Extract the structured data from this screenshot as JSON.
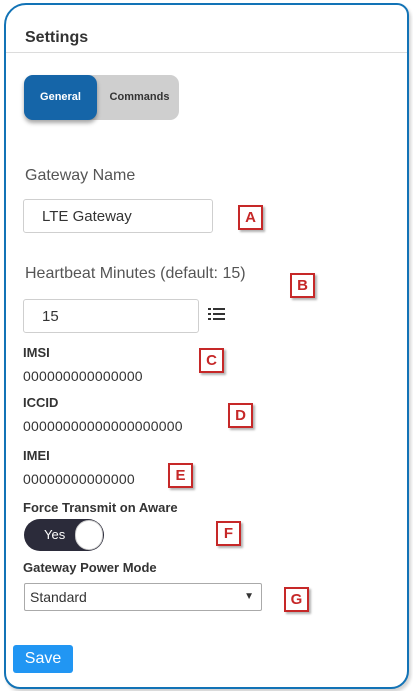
{
  "header": {
    "title": "Settings"
  },
  "tabs": [
    {
      "label": "General",
      "active": true
    },
    {
      "label": "Commands",
      "active": false
    }
  ],
  "fields": {
    "gateway_name": {
      "label": "Gateway Name",
      "value": "LTE Gateway"
    },
    "heartbeat": {
      "label": "Heartbeat Minutes (default: 15)",
      "value": "15"
    },
    "imsi": {
      "label": "IMSI",
      "value": "000000000000000"
    },
    "iccid": {
      "label": "ICCID",
      "value": "00000000000000000000"
    },
    "imei": {
      "label": "IMEI",
      "value": "00000000000000"
    },
    "force_transmit": {
      "label": "Force Transmit on Aware",
      "toggle_text": "Yes",
      "on": true
    },
    "power_mode": {
      "label": "Gateway Power Mode",
      "selected": "Standard"
    }
  },
  "markers": [
    "A",
    "B",
    "C",
    "D",
    "E",
    "F",
    "G"
  ],
  "actions": {
    "save_label": "Save"
  },
  "colors": {
    "accent": "#1565a8",
    "save": "#2196f3",
    "marker": "#c62828",
    "border": "#1273b6"
  },
  "icons": {
    "list": "list-icon",
    "caret": "caret-down-icon"
  }
}
